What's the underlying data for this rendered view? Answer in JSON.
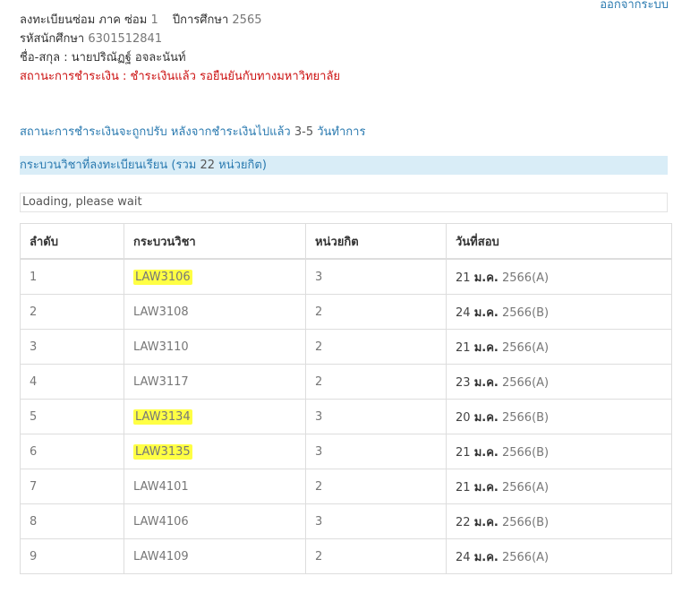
{
  "header": {
    "logout_label": "ออกจากระบบ"
  },
  "student": {
    "registration_label": "ลงทะเบียนซ่อม ภาค ซ่อม",
    "term": "1",
    "year_label": "ปีการศึกษา",
    "year": "2565",
    "id_label": "รหัสนักศึกษา",
    "id": "6301512841",
    "name_label": "ชื่อ-สกุล :",
    "name": "นายปริณัฏฐ์ อจละนันท์",
    "payment_status": "สถานะการชำระเงิน : ชำระเงินแล้ว รอยืนยันกับทางมหาวิทยาลัย"
  },
  "note": {
    "text": "สถานะการชำระเงินจะถูกปรับ หลังจากชำระเงินไปแล้ว",
    "days": "3-5",
    "suffix": "วันทำการ"
  },
  "section": {
    "title": "กระบวนวิชาที่ลงทะเบียนเรียน (รวม",
    "total": "22",
    "unit": "หน่วยกิต)"
  },
  "loading_text": "Loading, please wait",
  "table": {
    "headers": {
      "no": "ลำดับ",
      "course": "กระบวนวิชา",
      "credits": "หน่วยกิต",
      "exam_date": "วันที่สอบ"
    },
    "rows": [
      {
        "no": "1",
        "code": "LAW3106",
        "credits": "3",
        "day": "21",
        "month": "ม.ค.",
        "rest": "2566(A)",
        "highlighted": true
      },
      {
        "no": "2",
        "code": "LAW3108",
        "credits": "2",
        "day": "24",
        "month": "ม.ค.",
        "rest": "2566(B)",
        "highlighted": false
      },
      {
        "no": "3",
        "code": "LAW3110",
        "credits": "2",
        "day": "21",
        "month": "ม.ค.",
        "rest": "2566(A)",
        "highlighted": false
      },
      {
        "no": "4",
        "code": "LAW3117",
        "credits": "2",
        "day": "23",
        "month": "ม.ค.",
        "rest": "2566(A)",
        "highlighted": false
      },
      {
        "no": "5",
        "code": "LAW3134",
        "credits": "3",
        "day": "20",
        "month": "ม.ค.",
        "rest": "2566(B)",
        "highlighted": true
      },
      {
        "no": "6",
        "code": "LAW3135",
        "credits": "3",
        "day": "21",
        "month": "ม.ค.",
        "rest": "2566(B)",
        "highlighted": true
      },
      {
        "no": "7",
        "code": "LAW4101",
        "credits": "2",
        "day": "21",
        "month": "ม.ค.",
        "rest": "2566(A)",
        "highlighted": false
      },
      {
        "no": "8",
        "code": "LAW4106",
        "credits": "3",
        "day": "22",
        "month": "ม.ค.",
        "rest": "2566(B)",
        "highlighted": false
      },
      {
        "no": "9",
        "code": "LAW4109",
        "credits": "2",
        "day": "24",
        "month": "ม.ค.",
        "rest": "2566(A)",
        "highlighted": false
      }
    ]
  },
  "colors": {
    "link_blue": "#2a7ab0",
    "status_red": "#cc1111",
    "section_bg": "#d9edf7",
    "highlight": "#ffff44"
  }
}
